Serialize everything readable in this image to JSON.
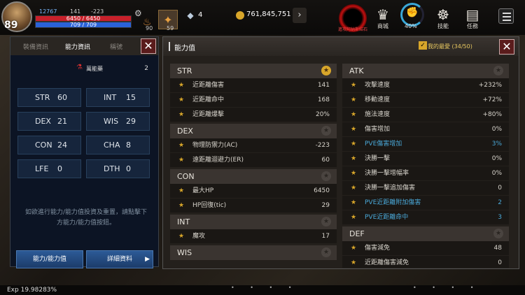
{
  "hud": {
    "level": "89",
    "small_stats": [
      "12767",
      "141",
      "-223"
    ],
    "hp": "6450 / 6450",
    "mp": "709 / 709",
    "bag_count": "90",
    "items_count": "59",
    "crystal_count": "4",
    "gold": "761,845,751",
    "portal_label": "進攻阿納斯結石",
    "ring_percent": "40%",
    "shop_label": "商城",
    "skill_label": "技能",
    "quest_label": "任務"
  },
  "left_panel": {
    "tabs": [
      "裝備資訊",
      "能力資訊",
      "稱號"
    ],
    "potion_label": "萬能藥",
    "potion_count": "2",
    "stats": [
      {
        "k": "STR",
        "v": "60"
      },
      {
        "k": "INT",
        "v": "15"
      },
      {
        "k": "DEX",
        "v": "21"
      },
      {
        "k": "WIS",
        "v": "29"
      },
      {
        "k": "CON",
        "v": "24"
      },
      {
        "k": "CHA",
        "v": "8"
      },
      {
        "k": "LFE",
        "v": "0"
      },
      {
        "k": "DTH",
        "v": "0"
      }
    ],
    "note": "如欲進行能力/能力值投資及重置，請點擊下方能力/能力值按鈕。",
    "btn_ability": "能力/能力值",
    "btn_detail": "詳細資料"
  },
  "right_panel": {
    "title": "能力值",
    "favorite": "我的最愛 (34/50)",
    "left_col": [
      {
        "name": "STR",
        "fav": true,
        "rows": [
          [
            "近距離傷害",
            "141"
          ],
          [
            "近距離命中",
            "168"
          ],
          [
            "近距離爆擊",
            "20%"
          ]
        ]
      },
      {
        "name": "DEX",
        "fav": false,
        "rows": [
          [
            "物理防禦力(AC)",
            "-223"
          ],
          [
            "遠距離迴避力(ER)",
            "60"
          ]
        ]
      },
      {
        "name": "CON",
        "fav": false,
        "rows": [
          [
            "最大HP",
            "6450"
          ],
          [
            "HP回復(tic)",
            "29"
          ]
        ]
      },
      {
        "name": "INT",
        "fav": false,
        "rows": [
          [
            "魔攻",
            "17"
          ]
        ]
      },
      {
        "name": "WIS",
        "fav": false,
        "rows": []
      }
    ],
    "right_col": [
      {
        "name": "ATK",
        "fav": false,
        "rows": [
          [
            "攻擊速度",
            "+232%",
            false
          ],
          [
            "移動速度",
            "+72%",
            false
          ],
          [
            "施法速度",
            "+80%",
            false
          ],
          [
            "傷害增加",
            "0%",
            false
          ],
          [
            "PVE傷害增加",
            "3%",
            true
          ],
          [
            "決勝一擊",
            "0%",
            false
          ],
          [
            "決勝一擊增幅率",
            "0%",
            false
          ],
          [
            "決勝一擊追加傷害",
            "0",
            false
          ],
          [
            "PVE近距離附加傷害",
            "2",
            true
          ],
          [
            "PVE近距離命中",
            "3",
            true
          ]
        ]
      },
      {
        "name": "DEF",
        "fav": false,
        "rows": [
          [
            "傷害減免",
            "48",
            false
          ],
          [
            "近距離傷害減免",
            "0",
            false
          ]
        ]
      }
    ]
  },
  "footer": {
    "exp": "Exp 19.98283%"
  }
}
